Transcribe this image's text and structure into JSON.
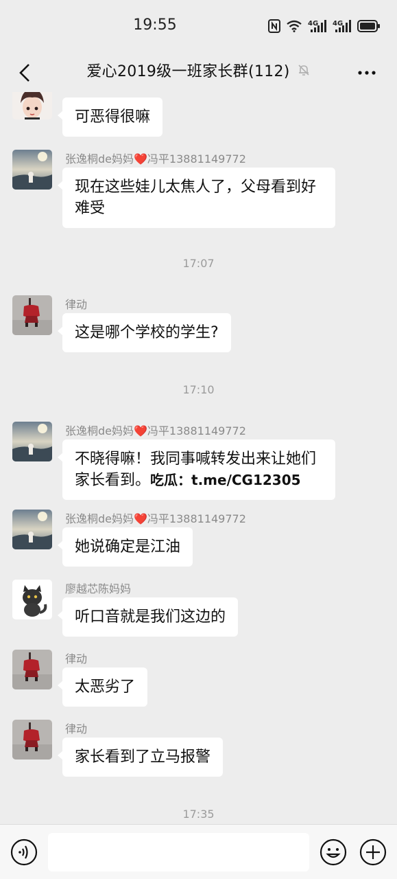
{
  "status_bar": {
    "time": "19:55",
    "icons": [
      "nfc-icon",
      "wifi-icon",
      "signal-4g-icon",
      "signal-4g-icon",
      "battery-icon"
    ],
    "network_label": "4G"
  },
  "header": {
    "title": "爱心2019级一班家长群(112)",
    "back_icon": "chevron-left-icon",
    "mute_icon": "bell-off-icon",
    "more_icon": "more-dots-icon"
  },
  "messages": [
    {
      "type": "message",
      "sender": "",
      "text": "可恶得很嘛",
      "avatar": "avatar-girl"
    },
    {
      "type": "message",
      "sender": "张逸桐de妈妈❤️冯平13881149772",
      "text": "现在这些娃儿太焦人了，父母看到好难受",
      "avatar": "avatar-sky"
    },
    {
      "type": "time",
      "text": "17:07"
    },
    {
      "type": "message",
      "sender": "律动",
      "text": "这是哪个学校的学生?",
      "avatar": "avatar-red"
    },
    {
      "type": "time",
      "text": "17:10"
    },
    {
      "type": "message",
      "sender": "张逸桐de妈妈❤️冯平13881149772",
      "text": "不晓得嘛！我同事喊转发出来让她们家长看到。",
      "text_bold": "吃瓜：t.me/CG12305",
      "avatar": "avatar-sky"
    },
    {
      "type": "message",
      "sender": "张逸桐de妈妈❤️冯平13881149772",
      "text": "她说确定是江油",
      "avatar": "avatar-sky"
    },
    {
      "type": "message",
      "sender": "廖越芯陈妈妈",
      "text": "听口音就是我们这边的",
      "avatar": "avatar-cat"
    },
    {
      "type": "message",
      "sender": "律动",
      "text": "太恶劣了",
      "avatar": "avatar-red"
    },
    {
      "type": "message",
      "sender": "律动",
      "text": "家长看到了立马报警",
      "avatar": "avatar-red"
    },
    {
      "type": "time",
      "text": "17:35"
    }
  ],
  "input_bar": {
    "placeholder": "",
    "voice_icon": "voice-icon",
    "emoji_icon": "emoji-icon",
    "plus_icon": "plus-icon"
  },
  "colors": {
    "background": "#ededed",
    "bubble": "#ffffff",
    "heart": "#e0232a"
  }
}
